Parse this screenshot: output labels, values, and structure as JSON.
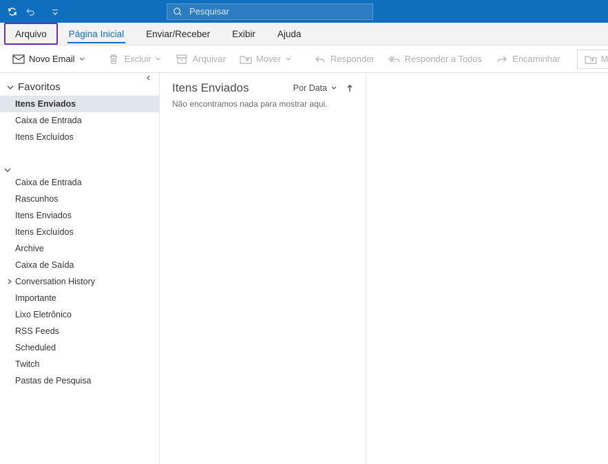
{
  "titlebar": {
    "search_placeholder": "Pesquisar"
  },
  "tabs": {
    "file": "Arquivo",
    "home": "Página Inicial",
    "sendreceive": "Enviar/Receber",
    "view": "Exibir",
    "help": "Ajuda"
  },
  "ribbon": {
    "new_email": "Novo Email",
    "delete": "Excluir",
    "archive": "Arquivar",
    "move": "Mover",
    "reply": "Responder",
    "reply_all": "Responder a Todos",
    "forward": "Encaminhar",
    "move_to": "Mover"
  },
  "nav": {
    "favorites_label": "Favoritos",
    "favorites": [
      {
        "label": "Itens Enviados",
        "selected": true
      },
      {
        "label": "Caixa de Entrada",
        "selected": false
      },
      {
        "label": "Itens Excluídos",
        "selected": false
      }
    ],
    "folders": [
      {
        "label": "Caixa de Entrada",
        "expander": false
      },
      {
        "label": "Rascunhos",
        "expander": false
      },
      {
        "label": "Itens Enviados",
        "expander": false
      },
      {
        "label": "Itens Excluídos",
        "expander": false
      },
      {
        "label": "Archive",
        "expander": false
      },
      {
        "label": "Caixa de Saída",
        "expander": false
      },
      {
        "label": "Conversation History",
        "expander": true
      },
      {
        "label": "Importante",
        "expander": false
      },
      {
        "label": "Lixo Eletrônico",
        "expander": false
      },
      {
        "label": "RSS Feeds",
        "expander": false
      },
      {
        "label": "Scheduled",
        "expander": false
      },
      {
        "label": "Twitch",
        "expander": false
      },
      {
        "label": "Pastas de Pesquisa",
        "expander": false
      }
    ]
  },
  "list": {
    "title": "Itens Enviados",
    "sort_label": "Por Data",
    "empty_message": "Não encontramos nada para mostrar aqui."
  }
}
